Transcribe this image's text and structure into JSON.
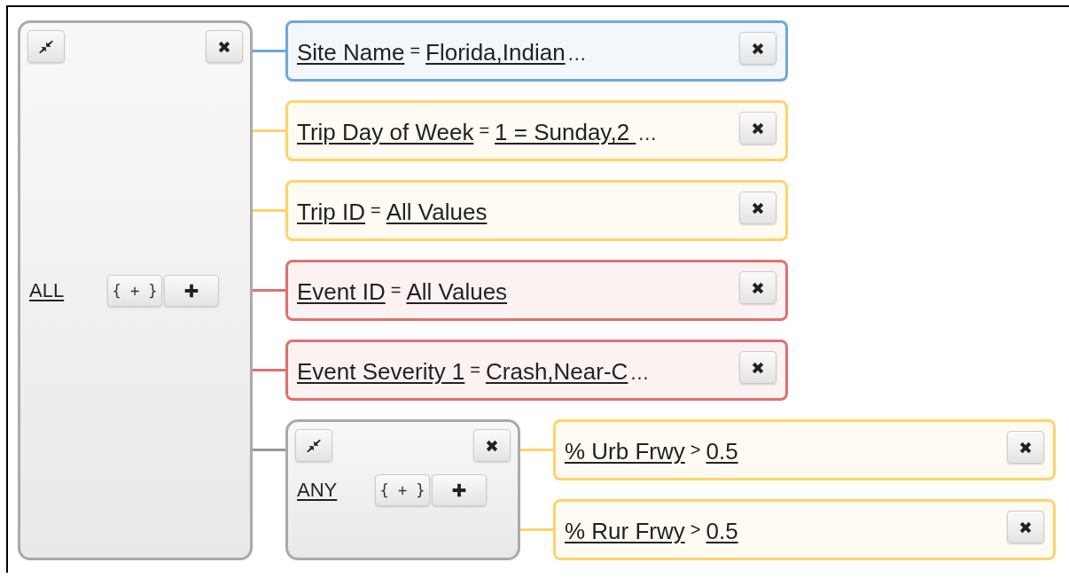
{
  "root": {
    "kind": "group",
    "operator": "ALL",
    "add_group_label": "{ + }",
    "children": [
      {
        "kind": "rule",
        "field": "Site Name",
        "operator": "=",
        "value": "Florida,Indian",
        "more": "…",
        "color": "#6fa8dc"
      },
      {
        "kind": "rule",
        "field": "Trip Day of Week",
        "operator": "=",
        "value": "1 = Sunday,2 ",
        "more": "…",
        "color": "#ffd36b"
      },
      {
        "kind": "rule",
        "field": "Trip ID",
        "operator": "=",
        "value": "All Values",
        "color": "#ffd36b"
      },
      {
        "kind": "rule",
        "field": "Event ID",
        "operator": "=",
        "value": "All Values",
        "color": "#e07070"
      },
      {
        "kind": "rule",
        "field": "Event Severity 1",
        "operator": "=",
        "value": "Crash,Near-C",
        "more": "…",
        "color": "#e07070"
      },
      {
        "kind": "group",
        "operator": "ANY",
        "add_group_label": "{ + }",
        "children": [
          {
            "kind": "rule",
            "field": "% Urb Frwy",
            "operator": ">",
            "value": "0.5",
            "color": "#ffd36b"
          },
          {
            "kind": "rule",
            "field": "% Rur Frwy",
            "operator": ">",
            "value": "0.5",
            "color": "#ffd36b"
          }
        ]
      }
    ]
  }
}
